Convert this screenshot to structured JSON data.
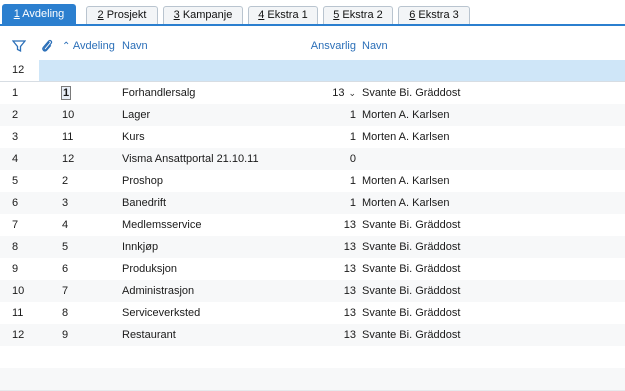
{
  "tabs": [
    {
      "key": "1",
      "label": "Avdeling",
      "active": true
    },
    {
      "key": "2",
      "label": "Prosjekt",
      "active": false
    },
    {
      "key": "3",
      "label": "Kampanje",
      "active": false
    },
    {
      "key": "4",
      "label": "Ekstra 1",
      "active": false
    },
    {
      "key": "5",
      "label": "Ekstra 2",
      "active": false
    },
    {
      "key": "6",
      "label": "Ekstra 3",
      "active": false
    }
  ],
  "header": {
    "col_avdeling": "Avdeling",
    "col_navn": "Navn",
    "col_ansvarlig": "Ansvarlig",
    "col_ansvarlig_navn": "Navn",
    "filter_icon": "filter-icon",
    "attachment_icon": "paperclip-icon",
    "sort_icon": "sort-up-icon"
  },
  "filter_row": {
    "count": "12"
  },
  "rows": [
    {
      "idx": "1",
      "avdeling": "1",
      "navn": "Forhandlersalg",
      "ansvarlig": "13",
      "ansvarlig_navn": "Svante Bi. Gräddost"
    },
    {
      "idx": "2",
      "avdeling": "10",
      "navn": "Lager",
      "ansvarlig": "1",
      "ansvarlig_navn": "Morten A. Karlsen"
    },
    {
      "idx": "3",
      "avdeling": "11",
      "navn": "Kurs",
      "ansvarlig": "1",
      "ansvarlig_navn": "Morten A. Karlsen"
    },
    {
      "idx": "4",
      "avdeling": "12",
      "navn": "Visma Ansattportal 21.10.11",
      "ansvarlig": "0",
      "ansvarlig_navn": ""
    },
    {
      "idx": "5",
      "avdeling": "2",
      "navn": "Proshop",
      "ansvarlig": "1",
      "ansvarlig_navn": "Morten A. Karlsen"
    },
    {
      "idx": "6",
      "avdeling": "3",
      "navn": "Banedrift",
      "ansvarlig": "1",
      "ansvarlig_navn": "Morten A. Karlsen"
    },
    {
      "idx": "7",
      "avdeling": "4",
      "navn": "Medlemsservice",
      "ansvarlig": "13",
      "ansvarlig_navn": "Svante Bi. Gräddost"
    },
    {
      "idx": "8",
      "avdeling": "5",
      "navn": "Innkjøp",
      "ansvarlig": "13",
      "ansvarlig_navn": "Svante Bi. Gräddost"
    },
    {
      "idx": "9",
      "avdeling": "6",
      "navn": "Produksjon",
      "ansvarlig": "13",
      "ansvarlig_navn": "Svante Bi. Gräddost"
    },
    {
      "idx": "10",
      "avdeling": "7",
      "navn": "Administrasjon",
      "ansvarlig": "13",
      "ansvarlig_navn": "Svante Bi. Gräddost"
    },
    {
      "idx": "11",
      "avdeling": "8",
      "navn": "Serviceverksted",
      "ansvarlig": "13",
      "ansvarlig_navn": "Svante Bi. Gräddost"
    },
    {
      "idx": "12",
      "avdeling": "9",
      "navn": "Restaurant",
      "ansvarlig": "13",
      "ansvarlig_navn": "Svante Bi. Gräddost"
    }
  ],
  "colors": {
    "accent": "#2b7fcf",
    "header_text": "#2b6fb8",
    "filter_band": "#cfe6f8"
  }
}
